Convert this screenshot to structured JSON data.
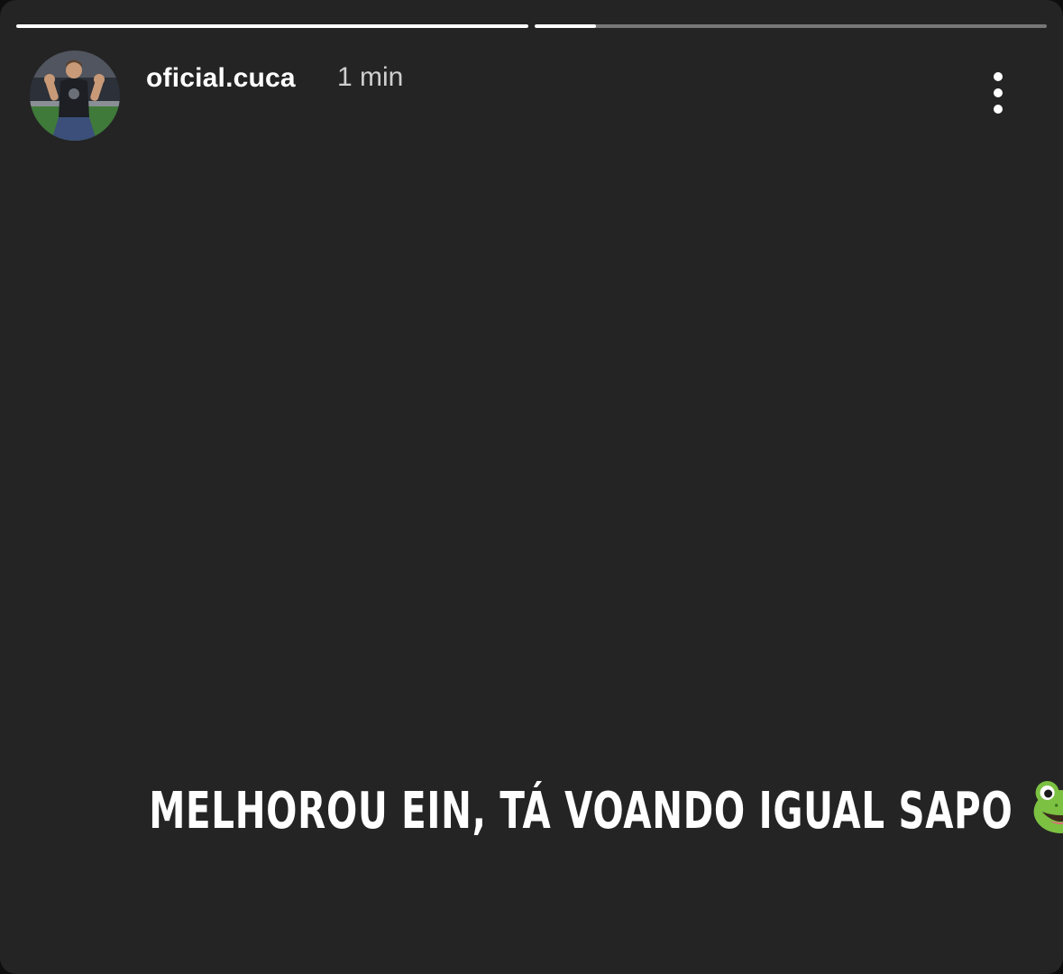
{
  "progress": {
    "segments": [
      {
        "label": "story-1",
        "completed": 1.0
      },
      {
        "label": "story-2",
        "completed": 0.12
      }
    ]
  },
  "header": {
    "username": "oficial.cuca",
    "timestamp": "1 min",
    "more_icon": "three-dots-vertical-icon"
  },
  "story": {
    "caption": "MELHOROU EIN, TÁ VOANDO IGUAL SAPO",
    "emoji": "frog-icon",
    "background": "#242424"
  }
}
